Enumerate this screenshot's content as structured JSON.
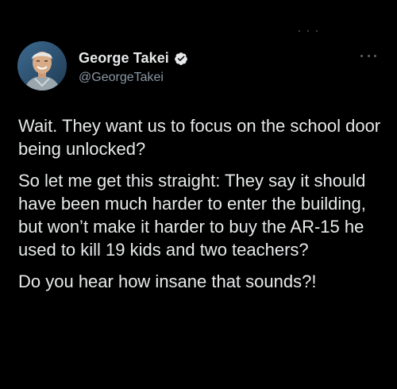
{
  "author": {
    "display_name": "George Takei",
    "handle": "@GeorgeTakei",
    "verified": true,
    "avatar_icon": "profile-photo"
  },
  "tweet": {
    "paragraphs": [
      "Wait. They want us to focus on the school door being unlocked?",
      "So let me get this straight: They say it should have been much harder to enter the building, but won’t make it harder to buy the AR-15 he used to kill 19 kids and two teachers?",
      "Do you hear how insane that sounds?!"
    ]
  },
  "icons": {
    "verified": "verified-badge-icon",
    "more": "more-options-icon"
  },
  "colors": {
    "background": "#000000",
    "text": "#e7e9ea",
    "secondary_text": "#8b98a5",
    "verified_badge": "#e7e9ea"
  }
}
